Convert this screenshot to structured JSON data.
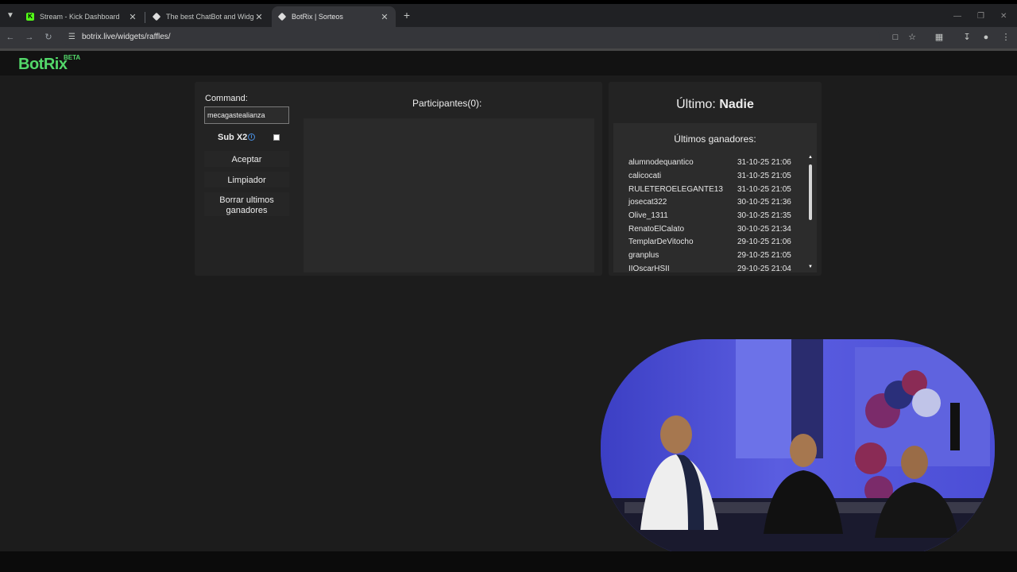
{
  "browser": {
    "tabs": [
      {
        "title": "Stream - Kick Dashboard",
        "favicon": "kick-logo-icon",
        "active": false
      },
      {
        "title": "The best ChatBot and Widgets",
        "favicon": "botrix-diamond-icon",
        "active": false
      },
      {
        "title": "BotRix | Sorteos",
        "favicon": "botrix-diamond-icon",
        "active": true
      }
    ],
    "url": "botrix.live/widgets/raffles/"
  },
  "header": {
    "logo": "BotRix",
    "badge": "BETA",
    "brand_color": "#53d86a"
  },
  "raffle": {
    "command_label": "Command:",
    "command_value": "mecagastealianza",
    "sub_label": "Sub X2",
    "sub_checked": false,
    "accept_button": "Aceptar",
    "clear_button": "Limpiador",
    "clear_winners_button": "Borrar ultimos ganadores",
    "participants_title": "Participantes(0):"
  },
  "winners": {
    "last_prefix": "Último:",
    "last_name": "Nadie",
    "list_title": "Últimos ganadores:",
    "items": [
      {
        "name": "alumnodequantico",
        "date": "31-10-25 21:06"
      },
      {
        "name": "calicocati",
        "date": "31-10-25 21:05"
      },
      {
        "name": "RULETEROELEGANTE13",
        "date": "31-10-25 21:05"
      },
      {
        "name": "josecat322",
        "date": "30-10-25 21:36"
      },
      {
        "name": "Olive_1311",
        "date": "30-10-25 21:35"
      },
      {
        "name": "RenatoElCalato",
        "date": "30-10-25 21:34"
      },
      {
        "name": "TemplarDeVitocho",
        "date": "29-10-25 21:06"
      },
      {
        "name": "granplus",
        "date": "29-10-25 21:05"
      },
      {
        "name": "IIOscarHSII",
        "date": "29-10-25 21:04"
      }
    ]
  }
}
